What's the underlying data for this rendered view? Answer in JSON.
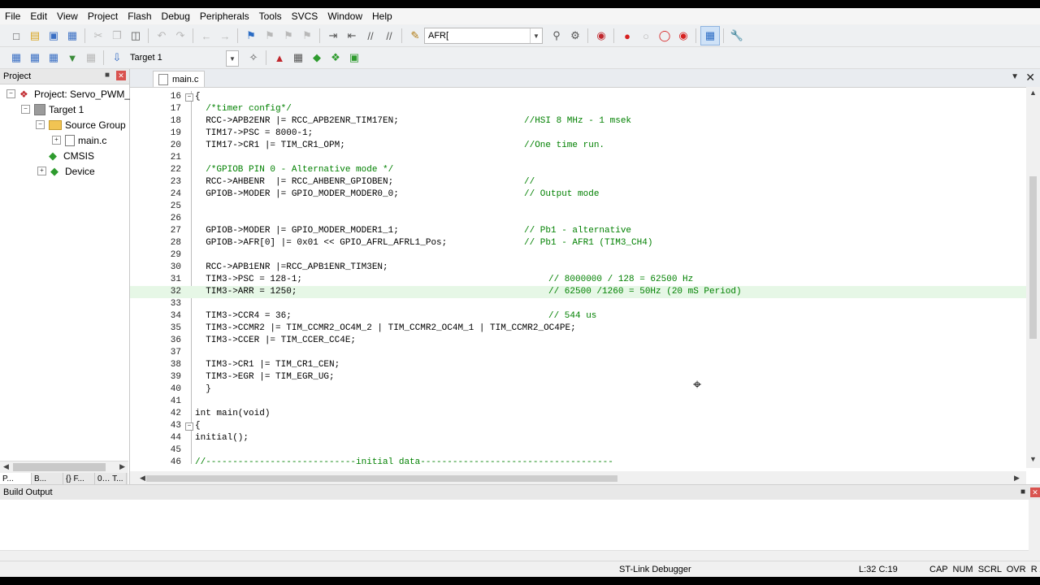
{
  "menu": [
    "File",
    "Edit",
    "View",
    "Project",
    "Flash",
    "Debug",
    "Peripherals",
    "Tools",
    "SVCS",
    "Window",
    "Help"
  ],
  "toolbar": {
    "find_value": "AFR[",
    "target_value": "Target 1"
  },
  "project_panel": {
    "title": "Project",
    "tree": [
      {
        "label": "Project: Servo_PWM_32",
        "icon": "project-icon"
      },
      {
        "label": "Target 1",
        "icon": "target-icon"
      },
      {
        "label": "Source Group",
        "icon": "folder-icon"
      },
      {
        "label": "main.c",
        "icon": "file-icon"
      },
      {
        "label": "CMSIS",
        "icon": "gem-icon"
      },
      {
        "label": "Device",
        "icon": "gem-icon"
      }
    ],
    "tabs": [
      "P...",
      "B...",
      "{} F...",
      "0… T..."
    ]
  },
  "editor": {
    "tab_label": "main.c",
    "lines": [
      {
        "n": "16",
        "t": "{",
        "c": ""
      },
      {
        "n": "17",
        "t": "  /*timer config*/",
        "c": ""
      },
      {
        "n": "18",
        "t": "  RCC->APB2ENR |= RCC_APB2ENR_TIM17EN;",
        "c": "//HSI 8 MHz - 1 msek"
      },
      {
        "n": "19",
        "t": "  TIM17->PSC = 8000-1;",
        "c": ""
      },
      {
        "n": "20",
        "t": "  TIM17->CR1 |= TIM_CR1_OPM;",
        "c": "//One time run."
      },
      {
        "n": "21",
        "t": "",
        "c": ""
      },
      {
        "n": "22",
        "t": "  /*GPIOB PIN 0 - Alternative mode */",
        "c": ""
      },
      {
        "n": "23",
        "t": "  RCC->AHBENR  |= RCC_AHBENR_GPIOBEN;",
        "c": "//"
      },
      {
        "n": "24",
        "t": "  GPIOB->MODER |= GPIO_MODER_MODER0_0;",
        "c": "// Output mode"
      },
      {
        "n": "25",
        "t": "",
        "c": ""
      },
      {
        "n": "26",
        "t": "",
        "c": ""
      },
      {
        "n": "27",
        "t": "  GPIOB->MODER |= GPIO_MODER_MODER1_1;",
        "c": "// Pb1 - alternative"
      },
      {
        "n": "28",
        "t": "  GPIOB->AFR[0] |= 0x01 << GPIO_AFRL_AFRL1_Pos;",
        "c": "// Pb1 - AFR1 (TIM3_CH4)"
      },
      {
        "n": "29",
        "t": "",
        "c": ""
      },
      {
        "n": "30",
        "t": "  RCC->APB1ENR |=RCC_APB1ENR_TIM3EN;",
        "c": ""
      },
      {
        "n": "31",
        "t": "  TIM3->PSC = 128-1;",
        "c": "// 8000000 / 128 = 62500 Hz"
      },
      {
        "n": "32",
        "t": "  TIM3->ARR = 1250;",
        "c": "// 62500 /1260 = 50Hz (20 mS Period)"
      },
      {
        "n": "33",
        "t": "",
        "c": ""
      },
      {
        "n": "34",
        "t": "  TIM3->CCR4 = 36;",
        "c": "// 544 us"
      },
      {
        "n": "35",
        "t": "  TIM3->CCMR2 |= TIM_CCMR2_OC4M_2 | TIM_CCMR2_OC4M_1 | TIM_CCMR2_OC4PE;",
        "c": ""
      },
      {
        "n": "36",
        "t": "  TIM3->CCER |= TIM_CCER_CC4E;",
        "c": ""
      },
      {
        "n": "37",
        "t": "",
        "c": ""
      },
      {
        "n": "38",
        "t": "  TIM3->CR1 |= TIM_CR1_CEN;",
        "c": ""
      },
      {
        "n": "39",
        "t": "  TIM3->EGR |= TIM_EGR_UG;",
        "c": ""
      },
      {
        "n": "40",
        "t": "  }",
        "c": ""
      },
      {
        "n": "41",
        "t": "",
        "c": ""
      },
      {
        "n": "42",
        "t": "int main(void)",
        "c": ""
      },
      {
        "n": "43",
        "t": "{",
        "c": ""
      },
      {
        "n": "44",
        "t": "initial();",
        "c": ""
      },
      {
        "n": "45",
        "t": "",
        "c": ""
      },
      {
        "n": "46",
        "t": "//----------------------------initial data------------------------------------",
        "c": ""
      }
    ]
  },
  "build_output": {
    "title": "Build Output"
  },
  "status": {
    "debugger": "ST-Link Debugger",
    "position": "L:32 C:19",
    "flags": "CAP  NUM  SCRL  OVR  R /W"
  }
}
